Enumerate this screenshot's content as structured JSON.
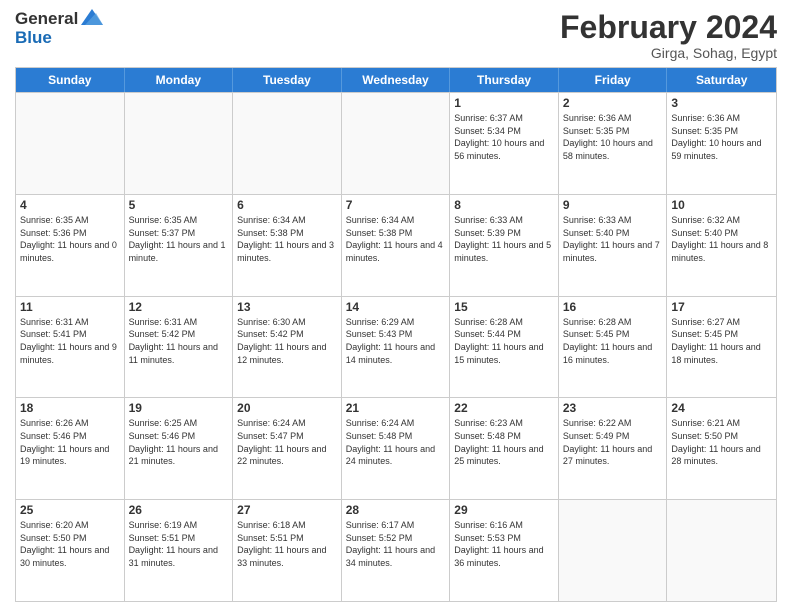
{
  "logo": {
    "line1": "General",
    "line2": "Blue"
  },
  "header": {
    "title": "February 2024",
    "subtitle": "Girga, Sohag, Egypt"
  },
  "days_of_week": [
    "Sunday",
    "Monday",
    "Tuesday",
    "Wednesday",
    "Thursday",
    "Friday",
    "Saturday"
  ],
  "weeks": [
    [
      {
        "day": "",
        "empty": true
      },
      {
        "day": "",
        "empty": true
      },
      {
        "day": "",
        "empty": true
      },
      {
        "day": "",
        "empty": true
      },
      {
        "day": "1",
        "sunrise": "6:37 AM",
        "sunset": "5:34 PM",
        "daylight": "10 hours and 56 minutes."
      },
      {
        "day": "2",
        "sunrise": "6:36 AM",
        "sunset": "5:35 PM",
        "daylight": "10 hours and 58 minutes."
      },
      {
        "day": "3",
        "sunrise": "6:36 AM",
        "sunset": "5:35 PM",
        "daylight": "10 hours and 59 minutes."
      }
    ],
    [
      {
        "day": "4",
        "sunrise": "6:35 AM",
        "sunset": "5:36 PM",
        "daylight": "11 hours and 0 minutes."
      },
      {
        "day": "5",
        "sunrise": "6:35 AM",
        "sunset": "5:37 PM",
        "daylight": "11 hours and 1 minute."
      },
      {
        "day": "6",
        "sunrise": "6:34 AM",
        "sunset": "5:38 PM",
        "daylight": "11 hours and 3 minutes."
      },
      {
        "day": "7",
        "sunrise": "6:34 AM",
        "sunset": "5:38 PM",
        "daylight": "11 hours and 4 minutes."
      },
      {
        "day": "8",
        "sunrise": "6:33 AM",
        "sunset": "5:39 PM",
        "daylight": "11 hours and 5 minutes."
      },
      {
        "day": "9",
        "sunrise": "6:33 AM",
        "sunset": "5:40 PM",
        "daylight": "11 hours and 7 minutes."
      },
      {
        "day": "10",
        "sunrise": "6:32 AM",
        "sunset": "5:40 PM",
        "daylight": "11 hours and 8 minutes."
      }
    ],
    [
      {
        "day": "11",
        "sunrise": "6:31 AM",
        "sunset": "5:41 PM",
        "daylight": "11 hours and 9 minutes."
      },
      {
        "day": "12",
        "sunrise": "6:31 AM",
        "sunset": "5:42 PM",
        "daylight": "11 hours and 11 minutes."
      },
      {
        "day": "13",
        "sunrise": "6:30 AM",
        "sunset": "5:42 PM",
        "daylight": "11 hours and 12 minutes."
      },
      {
        "day": "14",
        "sunrise": "6:29 AM",
        "sunset": "5:43 PM",
        "daylight": "11 hours and 14 minutes."
      },
      {
        "day": "15",
        "sunrise": "6:28 AM",
        "sunset": "5:44 PM",
        "daylight": "11 hours and 15 minutes."
      },
      {
        "day": "16",
        "sunrise": "6:28 AM",
        "sunset": "5:45 PM",
        "daylight": "11 hours and 16 minutes."
      },
      {
        "day": "17",
        "sunrise": "6:27 AM",
        "sunset": "5:45 PM",
        "daylight": "11 hours and 18 minutes."
      }
    ],
    [
      {
        "day": "18",
        "sunrise": "6:26 AM",
        "sunset": "5:46 PM",
        "daylight": "11 hours and 19 minutes."
      },
      {
        "day": "19",
        "sunrise": "6:25 AM",
        "sunset": "5:46 PM",
        "daylight": "11 hours and 21 minutes."
      },
      {
        "day": "20",
        "sunrise": "6:24 AM",
        "sunset": "5:47 PM",
        "daylight": "11 hours and 22 minutes."
      },
      {
        "day": "21",
        "sunrise": "6:24 AM",
        "sunset": "5:48 PM",
        "daylight": "11 hours and 24 minutes."
      },
      {
        "day": "22",
        "sunrise": "6:23 AM",
        "sunset": "5:48 PM",
        "daylight": "11 hours and 25 minutes."
      },
      {
        "day": "23",
        "sunrise": "6:22 AM",
        "sunset": "5:49 PM",
        "daylight": "11 hours and 27 minutes."
      },
      {
        "day": "24",
        "sunrise": "6:21 AM",
        "sunset": "5:50 PM",
        "daylight": "11 hours and 28 minutes."
      }
    ],
    [
      {
        "day": "25",
        "sunrise": "6:20 AM",
        "sunset": "5:50 PM",
        "daylight": "11 hours and 30 minutes."
      },
      {
        "day": "26",
        "sunrise": "6:19 AM",
        "sunset": "5:51 PM",
        "daylight": "11 hours and 31 minutes."
      },
      {
        "day": "27",
        "sunrise": "6:18 AM",
        "sunset": "5:51 PM",
        "daylight": "11 hours and 33 minutes."
      },
      {
        "day": "28",
        "sunrise": "6:17 AM",
        "sunset": "5:52 PM",
        "daylight": "11 hours and 34 minutes."
      },
      {
        "day": "29",
        "sunrise": "6:16 AM",
        "sunset": "5:53 PM",
        "daylight": "11 hours and 36 minutes."
      },
      {
        "day": "",
        "empty": true
      },
      {
        "day": "",
        "empty": true
      }
    ]
  ]
}
